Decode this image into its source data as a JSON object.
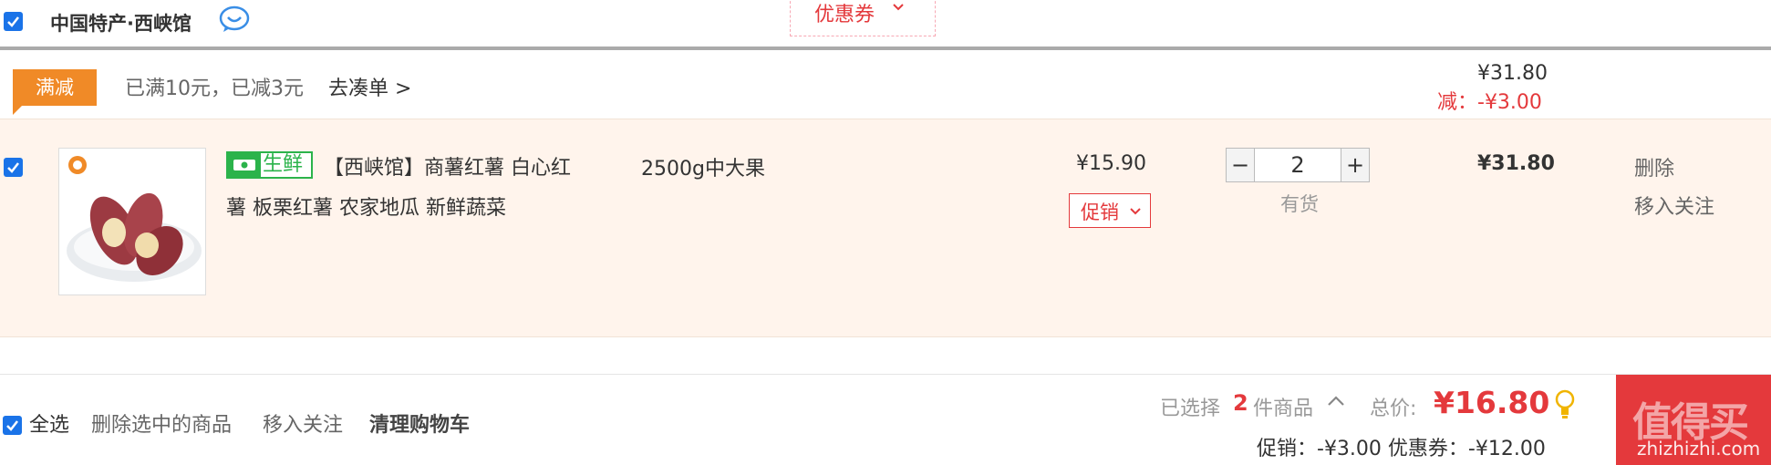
{
  "shop": {
    "name": "中国特产·西峡馆",
    "chat_icon": "chat-bubble-icon",
    "coupon_label": "优惠券"
  },
  "promo": {
    "badge": "满减",
    "text": "已满10元，已减3元",
    "link": "去凑单 >",
    "subtotal": "¥31.80",
    "discount": "减：-¥3.00"
  },
  "item": {
    "fresh_tag": "生鲜",
    "title_line1": "【西峡馆】商薯红薯 白心红",
    "title_line2": "薯 板栗红薯 农家地瓜 新鲜蔬菜",
    "spec": "2500g中大果",
    "price": "¥15.90",
    "promo_label": "促销",
    "quantity": "2",
    "minus": "−",
    "plus": "+",
    "stock": "有货",
    "subtotal": "¥31.80",
    "delete": "删除",
    "move_to_favorites": "移入关注"
  },
  "footer": {
    "select_all": "全选",
    "delete_selected": "删除选中的商品",
    "move_to_favorites": "移入关注",
    "clear_cart": "清理购物车",
    "selected_prefix": "已选择",
    "selected_count": "2",
    "selected_suffix": "件商品",
    "total_label": "总价:",
    "total_value": "¥16.80",
    "promo_summary": "促销：-¥3.00  优惠券：-¥12.00",
    "checkout_label": "值得买",
    "watermark": "zhizhizhi.com"
  },
  "colors": {
    "accent_red": "#e4393c",
    "promo_orange": "#f08a27",
    "fresh_green": "#2bb34b",
    "checkbox_blue": "#1a73e8"
  }
}
